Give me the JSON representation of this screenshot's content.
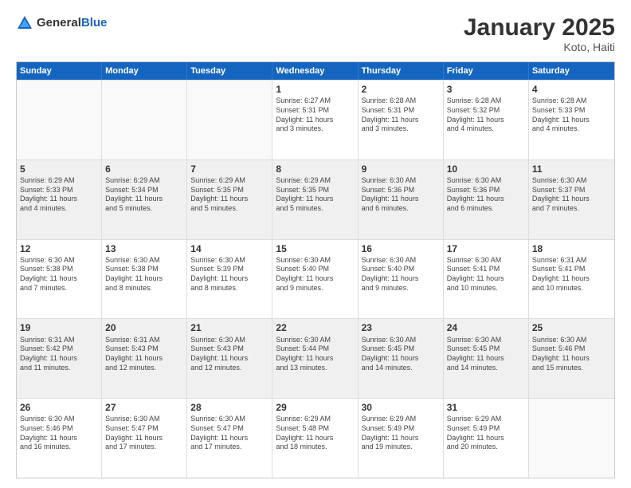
{
  "logo": {
    "text_general": "General",
    "text_blue": "Blue"
  },
  "title": "January 2025",
  "subtitle": "Koto, Haiti",
  "weekdays": [
    "Sunday",
    "Monday",
    "Tuesday",
    "Wednesday",
    "Thursday",
    "Friday",
    "Saturday"
  ],
  "weeks": [
    [
      {
        "day": "",
        "info": "",
        "empty": true
      },
      {
        "day": "",
        "info": "",
        "empty": true
      },
      {
        "day": "",
        "info": "",
        "empty": true
      },
      {
        "day": "1",
        "info": "Sunrise: 6:27 AM\nSunset: 5:31 PM\nDaylight: 11 hours\nand 3 minutes."
      },
      {
        "day": "2",
        "info": "Sunrise: 6:28 AM\nSunset: 5:31 PM\nDaylight: 11 hours\nand 3 minutes."
      },
      {
        "day": "3",
        "info": "Sunrise: 6:28 AM\nSunset: 5:32 PM\nDaylight: 11 hours\nand 4 minutes."
      },
      {
        "day": "4",
        "info": "Sunrise: 6:28 AM\nSunset: 5:33 PM\nDaylight: 11 hours\nand 4 minutes."
      }
    ],
    [
      {
        "day": "5",
        "info": "Sunrise: 6:29 AM\nSunset: 5:33 PM\nDaylight: 11 hours\nand 4 minutes."
      },
      {
        "day": "6",
        "info": "Sunrise: 6:29 AM\nSunset: 5:34 PM\nDaylight: 11 hours\nand 5 minutes."
      },
      {
        "day": "7",
        "info": "Sunrise: 6:29 AM\nSunset: 5:35 PM\nDaylight: 11 hours\nand 5 minutes."
      },
      {
        "day": "8",
        "info": "Sunrise: 6:29 AM\nSunset: 5:35 PM\nDaylight: 11 hours\nand 5 minutes."
      },
      {
        "day": "9",
        "info": "Sunrise: 6:30 AM\nSunset: 5:36 PM\nDaylight: 11 hours\nand 6 minutes."
      },
      {
        "day": "10",
        "info": "Sunrise: 6:30 AM\nSunset: 5:36 PM\nDaylight: 11 hours\nand 6 minutes."
      },
      {
        "day": "11",
        "info": "Sunrise: 6:30 AM\nSunset: 5:37 PM\nDaylight: 11 hours\nand 7 minutes."
      }
    ],
    [
      {
        "day": "12",
        "info": "Sunrise: 6:30 AM\nSunset: 5:38 PM\nDaylight: 11 hours\nand 7 minutes."
      },
      {
        "day": "13",
        "info": "Sunrise: 6:30 AM\nSunset: 5:38 PM\nDaylight: 11 hours\nand 8 minutes."
      },
      {
        "day": "14",
        "info": "Sunrise: 6:30 AM\nSunset: 5:39 PM\nDaylight: 11 hours\nand 8 minutes."
      },
      {
        "day": "15",
        "info": "Sunrise: 6:30 AM\nSunset: 5:40 PM\nDaylight: 11 hours\nand 9 minutes."
      },
      {
        "day": "16",
        "info": "Sunrise: 6:30 AM\nSunset: 5:40 PM\nDaylight: 11 hours\nand 9 minutes."
      },
      {
        "day": "17",
        "info": "Sunrise: 6:30 AM\nSunset: 5:41 PM\nDaylight: 11 hours\nand 10 minutes."
      },
      {
        "day": "18",
        "info": "Sunrise: 6:31 AM\nSunset: 5:41 PM\nDaylight: 11 hours\nand 10 minutes."
      }
    ],
    [
      {
        "day": "19",
        "info": "Sunrise: 6:31 AM\nSunset: 5:42 PM\nDaylight: 11 hours\nand 11 minutes."
      },
      {
        "day": "20",
        "info": "Sunrise: 6:31 AM\nSunset: 5:43 PM\nDaylight: 11 hours\nand 12 minutes."
      },
      {
        "day": "21",
        "info": "Sunrise: 6:30 AM\nSunset: 5:43 PM\nDaylight: 11 hours\nand 12 minutes."
      },
      {
        "day": "22",
        "info": "Sunrise: 6:30 AM\nSunset: 5:44 PM\nDaylight: 11 hours\nand 13 minutes."
      },
      {
        "day": "23",
        "info": "Sunrise: 6:30 AM\nSunset: 5:45 PM\nDaylight: 11 hours\nand 14 minutes."
      },
      {
        "day": "24",
        "info": "Sunrise: 6:30 AM\nSunset: 5:45 PM\nDaylight: 11 hours\nand 14 minutes."
      },
      {
        "day": "25",
        "info": "Sunrise: 6:30 AM\nSunset: 5:46 PM\nDaylight: 11 hours\nand 15 minutes."
      }
    ],
    [
      {
        "day": "26",
        "info": "Sunrise: 6:30 AM\nSunset: 5:46 PM\nDaylight: 11 hours\nand 16 minutes."
      },
      {
        "day": "27",
        "info": "Sunrise: 6:30 AM\nSunset: 5:47 PM\nDaylight: 11 hours\nand 17 minutes."
      },
      {
        "day": "28",
        "info": "Sunrise: 6:30 AM\nSunset: 5:47 PM\nDaylight: 11 hours\nand 17 minutes."
      },
      {
        "day": "29",
        "info": "Sunrise: 6:29 AM\nSunset: 5:48 PM\nDaylight: 11 hours\nand 18 minutes."
      },
      {
        "day": "30",
        "info": "Sunrise: 6:29 AM\nSunset: 5:49 PM\nDaylight: 11 hours\nand 19 minutes."
      },
      {
        "day": "31",
        "info": "Sunrise: 6:29 AM\nSunset: 5:49 PM\nDaylight: 11 hours\nand 20 minutes."
      },
      {
        "day": "",
        "info": "",
        "empty": true
      }
    ]
  ]
}
